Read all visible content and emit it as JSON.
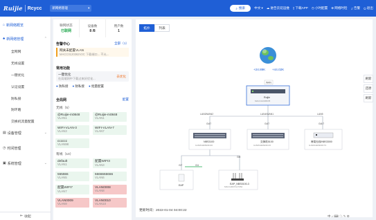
{
  "header": {
    "logo": "Ruijie",
    "logo_sub": "Rcycc",
    "network_select": "新网络管理",
    "search": "搜索",
    "language": "中文",
    "items": [
      "进告云延运维",
      "下载APP",
      "小时配置",
      "网络时检",
      "告警",
      "退出"
    ]
  },
  "sidebar": {
    "groups": [
      {
        "label": "新网络概览"
      },
      {
        "label": "新网络管理"
      },
      {
        "label": "设备管理"
      },
      {
        "label": "时间管理"
      },
      {
        "label": "系统管理"
      }
    ],
    "items": [
      "全网网",
      "无线设置",
      "一键优化",
      "认证设置",
      "防私接",
      "防环路",
      "交换机流量配置"
    ],
    "collapse": "收起"
  },
  "stats": [
    {
      "label": "联网状态",
      "value": "已联网"
    },
    {
      "label": "设备数",
      "value": "8 /8"
    },
    {
      "label": "用户数",
      "value": "1"
    }
  ],
  "alarm_center": {
    "title": "告警中心",
    "link": "全部（1）",
    "line1": "网关未配置VLAN",
    "line2": "MACC0120362V2C 下载端口... 不允..."
  },
  "functions": {
    "title": "常用功能",
    "name": "一键优化",
    "desc": "在局域网中下载过来好优化...",
    "tag": "去优化",
    "quick": [
      "防私接",
      "防私接",
      "批量配置"
    ]
  },
  "vlan": {
    "title": "全局网",
    "link": "配置",
    "wired_label": "无线（5）",
    "wireless_label": "有线（10）",
    "tiles": [
      {
        "name": "@Ruijie-m0848",
        "vlan": "VLAN1",
        "red": false
      },
      {
        "name": "@Ruijie-m0848",
        "vlan": "VLAN1",
        "red": false
      },
      {
        "name": "WIFI-VLAN-3",
        "vlan": "VLAN3",
        "red": false
      },
      {
        "name": "WIFI-VLAN-7",
        "vlan": "VLAN7",
        "red": false
      },
      {
        "name": "cccccc",
        "vlan": "VLAN98",
        "red": false
      },
      {
        "name": "default",
        "vlan": "VLAN1",
        "red": false
      },
      {
        "name": "配置WIFI3",
        "vlan": "VLAN3",
        "red": false
      },
      {
        "name": "555555",
        "vlan": "VLAN5",
        "red": false
      },
      {
        "name": "6666666666",
        "vlan": "VLAN6",
        "red": false
      },
      {
        "name": "配置WIFI7",
        "vlan": "VLAN7",
        "red": false
      },
      {
        "name": "VLAN0008",
        "vlan": "VLAN8",
        "red": true
      },
      {
        "name": "VLAN0009",
        "vlan": "VLAN9",
        "red": true
      },
      {
        "name": "VLAN0010",
        "vlan": "VLAN10",
        "red": true
      }
    ]
  },
  "main": {
    "tabs": [
      "拓扑",
      "列表"
    ],
    "float_buttons": [
      "刷新",
      "还原",
      "刷新"
    ],
    "upload": "+24.89K",
    "download": "+44.02K",
    "core": {
      "name": "Ruijie",
      "sn": "MACC12345678"
    },
    "core_port": "WAN",
    "switch_ports": [
      "LAN3/WAN2",
      "LAN4/WAN1",
      "LAN5"
    ],
    "switches": [
      {
        "name": "NBS3100",
        "sn": "G1NW42R900C36",
        "port": "Gi47"
      },
      {
        "name": "交换机5100",
        "sn": "G1NW42R900C15",
        "port": "Gi47"
      },
      {
        "name": "睿易无线/NBS3000",
        "sn": "G1NW42R900C73",
        "port": "Gi4/7"
      }
    ],
    "access_ports": [
      "Gi7",
      "Gi8"
    ],
    "aps": [
      {
        "name": "EAP",
        "sn": "",
        "port": "Gi3"
      },
      {
        "name": "EAP_NBS5100-3",
        "sn": "MACC2007G17052"
      }
    ],
    "ap_port": "Gi1",
    "update_time": "更新时间：2022-01-04 04:00:22"
  },
  "statusbar": "中 ♪ ⌨ ☁ ✎ ⚙"
}
